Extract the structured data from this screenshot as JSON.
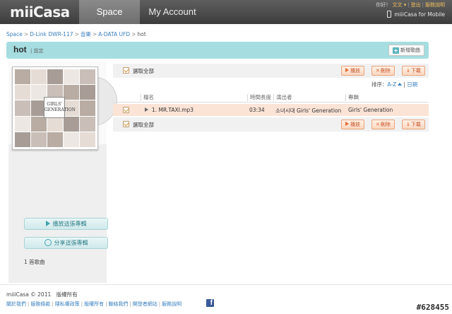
{
  "topbar": {
    "logo_main": "miiCasa",
    "tab_space": "Space",
    "tab_account": "My Account",
    "greeting": "你好！",
    "lang": "文文 ▾",
    "logout": "登出",
    "help": "服務說明",
    "mobile": "miiiCasa for Mobile"
  },
  "breadcrumb": [
    "Space",
    "D-Link DWR-117",
    "音樂",
    "A-DATA UFD",
    "hot"
  ],
  "header": {
    "title": "hot",
    "settings": "| 設定",
    "new_song": "新增歌曲"
  },
  "sidebar": {
    "play_album": "播放這張專輯",
    "share_album": "分享這張專輯",
    "song_count": "1 首歌曲",
    "cover_logo": "GIRLS' GENERATION"
  },
  "toolbar": {
    "select_all": "選取全部",
    "play": "播放",
    "delete": "刪除",
    "download": "下載"
  },
  "sort": {
    "label": "排序：",
    "az": "A-Z",
    "sep": "|",
    "date": "日期"
  },
  "table": {
    "headers": [
      "檔名",
      "時間長度",
      "演出者",
      "專輯"
    ],
    "rows": [
      {
        "name": "1. MR.TAXI.mp3",
        "duration": "03:34",
        "artist": "소녀시대 Girls' Generation",
        "album": "Girls' Generation"
      }
    ]
  },
  "footer": {
    "copyright": "miiiCasa © 2011　版權所有",
    "links": [
      "關於我們",
      "服務條款",
      "隱私權政策",
      "版權所有",
      "聯絡我們",
      "開發者網站",
      "服務說明"
    ]
  },
  "watermark": "#628455"
}
